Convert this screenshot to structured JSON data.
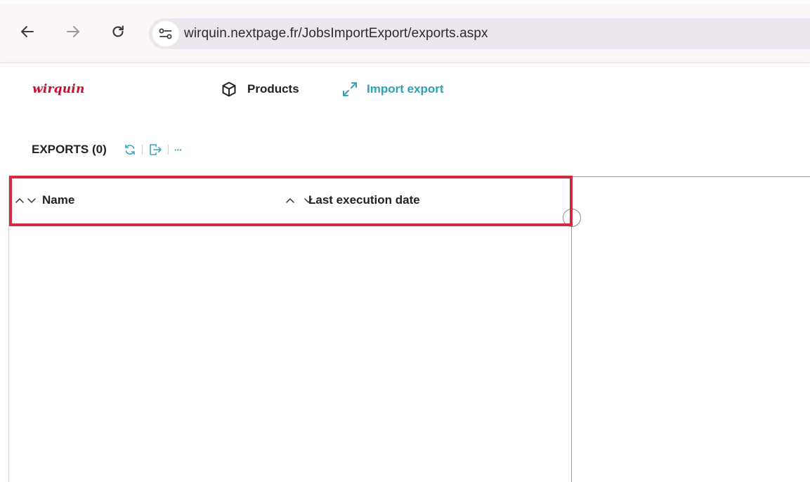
{
  "browser": {
    "url": "wirquin.nextpage.fr/JobsImportExport/exports.aspx",
    "icons": [
      "back-arrow-icon",
      "forward-arrow-icon",
      "reload-icon",
      "site-settings-icon"
    ]
  },
  "header": {
    "logo_text": "wirquin",
    "nav": [
      {
        "label": "Products",
        "icon": "cube-icon"
      },
      {
        "label": "Import export",
        "icon": "import-export-icon",
        "active": true
      }
    ]
  },
  "toolbar": {
    "title": "EXPORTS (0)",
    "icons": [
      "refresh-icon",
      "export-file-icon",
      "more-icon"
    ],
    "more_label": "···"
  },
  "table": {
    "columns": [
      {
        "label": "Name"
      },
      {
        "label": "Last execution date"
      }
    ],
    "rows": []
  },
  "colors": {
    "accent": "#2aa3b6",
    "brand": "#c8102e",
    "highlight": "#d3293d"
  }
}
